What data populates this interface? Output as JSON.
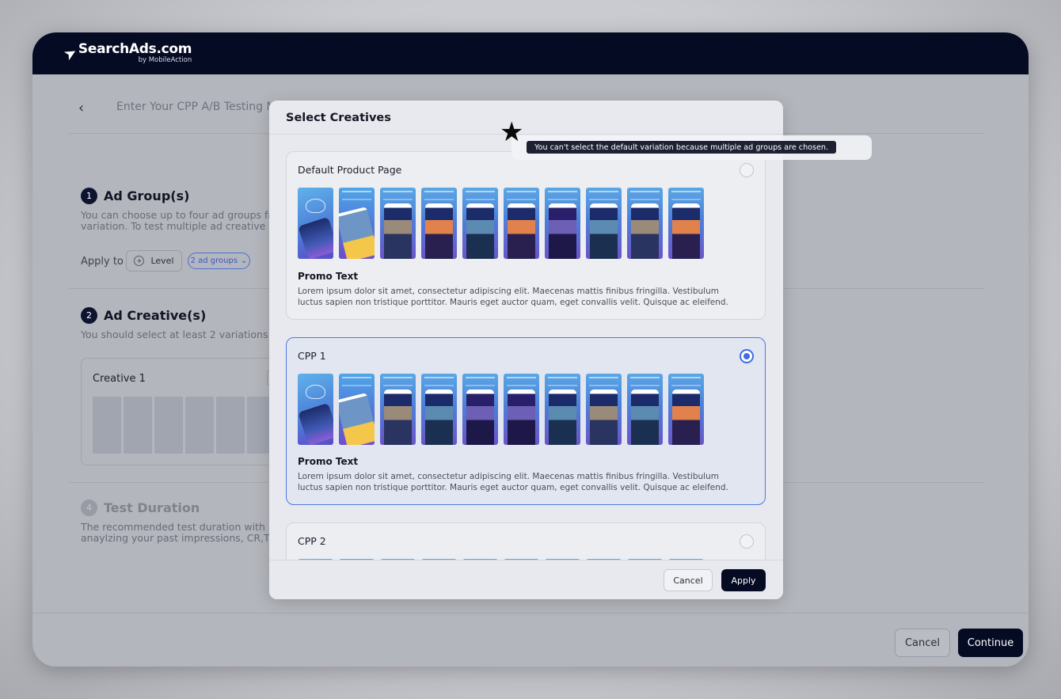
{
  "brand": {
    "name": "SearchAds.com",
    "byline": "by MobileAction"
  },
  "page": {
    "test_name_placeholder": "Enter Your CPP A/B Testing N",
    "steps": [
      {
        "number": "1",
        "title": "Ad Group(s)",
        "desc_line1": "You can choose up to four ad groups fro",
        "desc_line2": "variation. To test multiple ad creative va"
      },
      {
        "number": "2",
        "title": "Ad Creative(s)",
        "desc_line1": "You should select at least 2 variations. Yo"
      },
      {
        "number": "4",
        "title": "Test Duration",
        "desc_line1": "The recommended test duration with Da",
        "desc_line2": "anaylzing your  past impressions, CR,TTR"
      }
    ],
    "apply_to_label": "Apply to",
    "level_label": "Level",
    "ad_groups_pill": "2 ad groups",
    "creative_card_label": "Creative 1",
    "footer": {
      "cancel": "Cancel",
      "continue": "Continue"
    }
  },
  "modal": {
    "title": "Select Creatives",
    "variations": [
      {
        "name": "Default Product Page",
        "selected": false,
        "promo_title": "Promo Text",
        "promo_text": "Lorem ipsum dolor sit amet, consectetur adipiscing elit. Maecenas mattis finibus fringilla. Vestibulum luctus sapien non tristique porttitor. Mauris eget auctor quam, eget convallis velit. Quisque ac eleifend."
      },
      {
        "name": "CPP 1",
        "selected": true,
        "promo_title": "Promo Text",
        "promo_text": "Lorem ipsum dolor sit amet, consectetur adipiscing elit. Maecenas mattis finibus fringilla. Vestibulum luctus sapien non tristique porttitor. Mauris eget auctor quam, eget convallis velit. Quisque ac eleifend."
      },
      {
        "name": "CPP 2",
        "selected": false
      }
    ],
    "cancel_label": "Cancel",
    "apply_label": "Apply"
  },
  "tooltip": {
    "text": "You can't select the default variation because multiple ad groups are chosen."
  },
  "icons": {
    "logo": "rocket-icon",
    "back": "chevron-left-icon",
    "level": "circle-plus-icon",
    "pill_caret": "chevron-down-icon",
    "add": "plus-icon",
    "cursor": "star-icon"
  },
  "colors": {
    "brand_dark": "#060b24",
    "accent_blue": "#3d6ee0"
  }
}
